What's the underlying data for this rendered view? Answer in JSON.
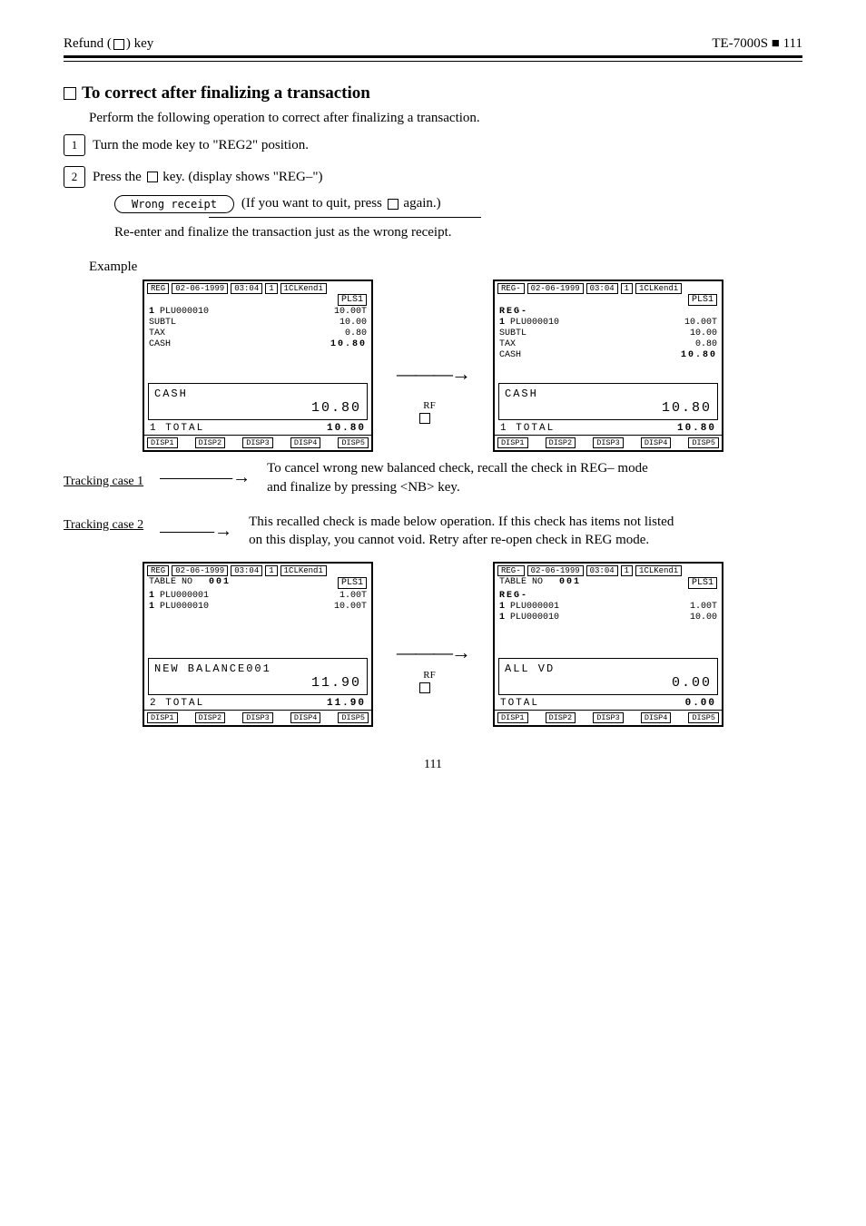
{
  "header": {
    "left_prefix": "Refund (",
    "left_key": "RF",
    "left_suffix": ") key",
    "right": "TE-7000S ■ 111"
  },
  "page_number": "111",
  "title_line": "To correct after finalizing a transaction",
  "intro": "Perform the following operation to correct after finalizing a transaction.",
  "steps": {
    "s1_num": "1",
    "s1_text": "Turn the mode key to \"REG2\" position.",
    "s2_num": "2",
    "s2a": "Press the ",
    "s2b": "RF",
    "s2c": " key. (display shows \"REG–\")",
    "s3_prefix": "(If you want to quit, press ",
    "s3_key": "RF",
    "s3_suffix": " again.)"
  },
  "receipt_pill": "Wrong receipt",
  "after_step": "Re-enter and finalize the transaction just as the wrong receipt.",
  "example_label": "Example",
  "rf_label": "RF",
  "lcd_a": {
    "hdr": {
      "mode": "REG",
      "date": "02-06-1999",
      "time": "03:04",
      "n": "1",
      "clk": "1CLKendi",
      "pls": "PLS1"
    },
    "lines": [
      [
        "  1 PLU000010",
        "10.00T"
      ],
      [
        "SUBTL",
        "10.00"
      ],
      [
        "TAX",
        "0.80"
      ],
      [
        "CASH",
        "10.80"
      ]
    ],
    "big_label": "CASH",
    "big_val": "10.80",
    "tot_left": "1   TOTAL",
    "tot_right": "10.80",
    "ftr": [
      "DISP1",
      "DISP2",
      "DISP3",
      "DISP4",
      "DISP5"
    ]
  },
  "lcd_b": {
    "hdr": {
      "mode": "REG-",
      "date": "02-06-1999",
      "time": "03:04",
      "n": "1",
      "clk": "1CLKendi",
      "pls": "PLS1"
    },
    "extra": "REG-",
    "lines": [
      [
        "  1 PLU000010",
        "10.00T"
      ],
      [
        "SUBTL",
        "10.00"
      ],
      [
        "TAX",
        "0.80"
      ],
      [
        "CASH",
        "10.80"
      ]
    ],
    "big_label": "CASH",
    "big_val": "10.80",
    "tot_left": "1   TOTAL",
    "tot_right": "10.80",
    "ftr": [
      "DISP1",
      "DISP2",
      "DISP3",
      "DISP4",
      "DISP5"
    ]
  },
  "case1": {
    "title": "Tracking case 1",
    "desc": "To cancel wrong new balanced check, recall the check in REG– mode and finalize by pressing <NB> key."
  },
  "case2": {
    "title": "Tracking case 2",
    "desc": "This recalled check is made below operation. If this check has items not listed on this display, you cannot void. Retry after re-open check in REG mode."
  },
  "lcd_c": {
    "hdr": {
      "mode": "REG",
      "date": "02-06-1999",
      "time": "03:04",
      "n": "1",
      "clk": "1CLKendi",
      "pls": "PLS1"
    },
    "table": "TABLE NO   001",
    "lines": [
      [
        "  1 PLU000001",
        "1.00T"
      ],
      [
        "  1 PLU000010",
        "10.00T"
      ]
    ],
    "big_label": "NEW BALANCE001",
    "big_val": "11.90",
    "tot_left": "2   TOTAL",
    "tot_right": "11.90",
    "ftr": [
      "DISP1",
      "DISP2",
      "DISP3",
      "DISP4",
      "DISP5"
    ]
  },
  "lcd_d": {
    "hdr": {
      "mode": "REG-",
      "date": "02-06-1999",
      "time": "03:04",
      "n": "1",
      "clk": "1CLKendi",
      "pls": "PLS1"
    },
    "table": "TABLE NO   001",
    "extra": "REG-",
    "lines": [
      [
        "  1 PLU000001",
        "1.00T"
      ],
      [
        "  1 PLU000010",
        "10.00"
      ]
    ],
    "big_label": "ALL VD",
    "big_val": "0.00",
    "tot_left": "    TOTAL",
    "tot_right": "0.00",
    "ftr": [
      "DISP1",
      "DISP2",
      "DISP3",
      "DISP4",
      "DISP5"
    ]
  }
}
